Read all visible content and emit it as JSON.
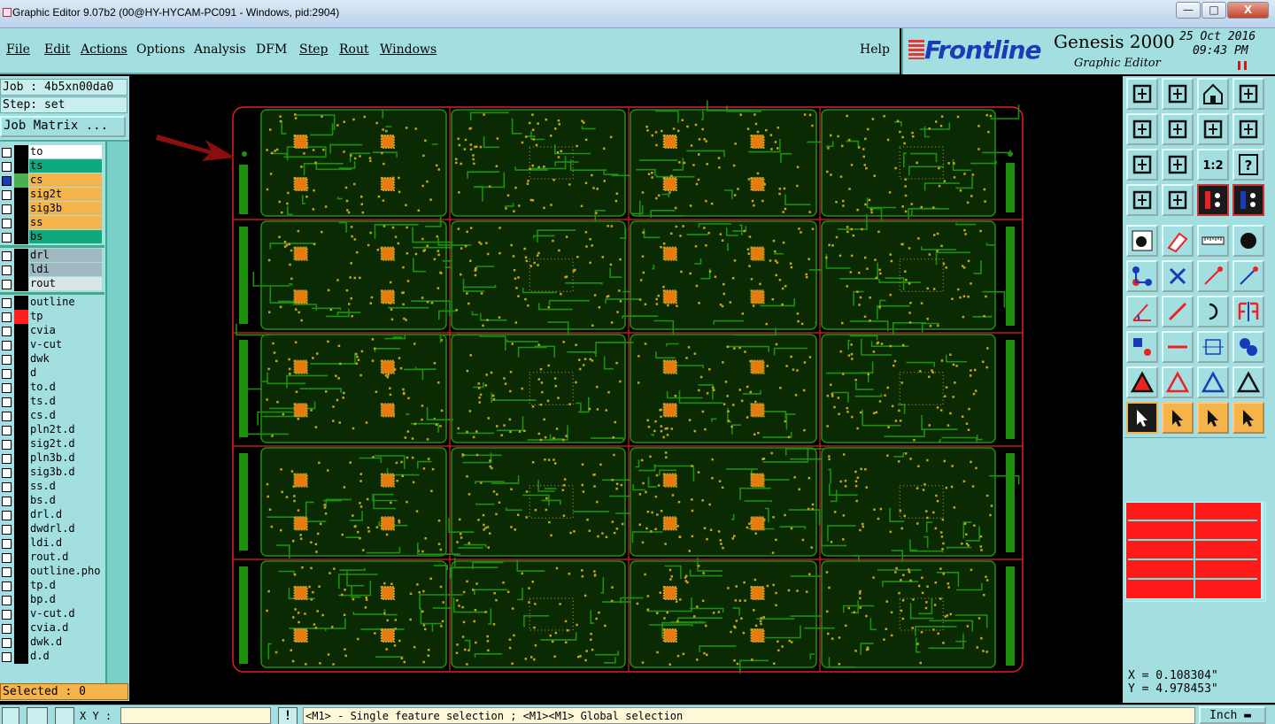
{
  "window": {
    "title": "Graphic Editor 9.07b2 (00@HY-HYCAM-PC091 - Windows, pid:2904)",
    "min": "—",
    "max": "□",
    "close": "X"
  },
  "menu": [
    "File",
    "Edit",
    "Actions",
    "Options",
    "Analysis",
    "DFM",
    "Step",
    "Rout",
    "Windows"
  ],
  "help": "Help",
  "brand": {
    "logo": "Frontline",
    "product": "Genesis 2000",
    "subtitle": "Graphic Editor",
    "date": "25 Oct 2016",
    "time": "09:43 PM"
  },
  "job": {
    "job_line": "Job : 4b5xn00da0",
    "step_line": "Step: set",
    "matrix_button": "Job Matrix ..."
  },
  "layer_groups": [
    [
      {
        "name": "to",
        "color": "#ffffff",
        "checked": false
      },
      {
        "name": "ts",
        "color": "#0fa97e",
        "checked": false
      },
      {
        "name": "cs",
        "color": "#f5b44a",
        "checked": true,
        "marker": "#4caf50"
      },
      {
        "name": "sig2t",
        "color": "#f5b44a",
        "checked": false
      },
      {
        "name": "sig3b",
        "color": "#f5b44a",
        "checked": false
      },
      {
        "name": "ss",
        "color": "#f5b44a",
        "checked": false
      },
      {
        "name": "bs",
        "color": "#0fa97e",
        "checked": false
      }
    ],
    [
      {
        "name": "drl",
        "color": "#a0b8c0",
        "checked": false
      },
      {
        "name": "ldi",
        "color": "#a0b8c0",
        "checked": false
      },
      {
        "name": "rout",
        "color": "#d8e6e8",
        "checked": false
      }
    ],
    [
      {
        "name": "outline",
        "color": "#a3dfe0",
        "checked": false
      },
      {
        "name": "tp",
        "color": "#a3dfe0",
        "checked": false,
        "marker": "#ff2020"
      },
      {
        "name": "cvia",
        "color": "#a3dfe0",
        "checked": false
      },
      {
        "name": "v-cut",
        "color": "#a3dfe0",
        "checked": false
      },
      {
        "name": "dwk",
        "color": "#a3dfe0",
        "checked": false
      },
      {
        "name": "d",
        "color": "#a3dfe0",
        "checked": false
      },
      {
        "name": "to.d",
        "color": "#a3dfe0",
        "checked": false
      },
      {
        "name": "ts.d",
        "color": "#a3dfe0",
        "checked": false
      },
      {
        "name": "cs.d",
        "color": "#a3dfe0",
        "checked": false
      },
      {
        "name": "pln2t.d",
        "color": "#a3dfe0",
        "checked": false
      },
      {
        "name": "sig2t.d",
        "color": "#a3dfe0",
        "checked": false
      },
      {
        "name": "pln3b.d",
        "color": "#a3dfe0",
        "checked": false
      },
      {
        "name": "sig3b.d",
        "color": "#a3dfe0",
        "checked": false
      },
      {
        "name": "ss.d",
        "color": "#a3dfe0",
        "checked": false
      },
      {
        "name": "bs.d",
        "color": "#a3dfe0",
        "checked": false
      },
      {
        "name": "drl.d",
        "color": "#a3dfe0",
        "checked": false
      },
      {
        "name": "dwdrl.d",
        "color": "#a3dfe0",
        "checked": false
      },
      {
        "name": "ldi.d",
        "color": "#a3dfe0",
        "checked": false
      },
      {
        "name": "rout.d",
        "color": "#a3dfe0",
        "checked": false
      },
      {
        "name": "outline.pho",
        "color": "#a3dfe0",
        "checked": false
      },
      {
        "name": "tp.d",
        "color": "#a3dfe0",
        "checked": false
      },
      {
        "name": "bp.d",
        "color": "#a3dfe0",
        "checked": false
      },
      {
        "name": "v-cut.d",
        "color": "#a3dfe0",
        "checked": false
      },
      {
        "name": "cvia.d",
        "color": "#a3dfe0",
        "checked": false
      },
      {
        "name": "dwk.d",
        "color": "#a3dfe0",
        "checked": false
      },
      {
        "name": "d.d",
        "color": "#a3dfe0",
        "checked": false
      }
    ]
  ],
  "selected": "Selected : 0",
  "coords": {
    "x": "X = 0.108304\"",
    "y": "Y = 4.978453\""
  },
  "bottom": {
    "xy_label": "X Y :",
    "xy_value": "",
    "status": "<M1> - Single feature selection ; <M1><M1> Global selection",
    "units": "Inch"
  },
  "toolbar": [
    {
      "name": "zoom-home-icon",
      "style": "normal"
    },
    {
      "name": "zoom-in-icon",
      "style": "normal"
    },
    {
      "name": "home-icon",
      "style": "normal"
    },
    {
      "name": "zoom-window-icon",
      "style": "normal"
    },
    {
      "name": "pan-left-icon",
      "style": "normal"
    },
    {
      "name": "pan-right-icon",
      "style": "normal"
    },
    {
      "name": "pan-up-down-icon",
      "style": "normal"
    },
    {
      "name": "redraw-icon",
      "style": "normal"
    },
    {
      "name": "fit-icon",
      "style": "normal"
    },
    {
      "name": "center-icon",
      "style": "normal"
    },
    {
      "name": "scale-1to2-icon",
      "style": "normal"
    },
    {
      "name": "help-question-icon",
      "style": "normal"
    },
    {
      "name": "measure-icon",
      "style": "normal"
    },
    {
      "name": "snap-icon",
      "style": "normal"
    },
    {
      "name": "layers-red-icon",
      "style": "dark"
    },
    {
      "name": "layers-blue-icon",
      "style": "dark"
    },
    {
      "name": "add-pad-icon",
      "style": "normal"
    },
    {
      "name": "add-surface-icon",
      "style": "normal"
    },
    {
      "name": "ruler-icon",
      "style": "normal"
    },
    {
      "name": "circle-icon",
      "style": "normal"
    },
    {
      "name": "connect-icon",
      "style": "normal"
    },
    {
      "name": "delete-x-icon",
      "style": "normal"
    },
    {
      "name": "line-red-icon",
      "style": "normal"
    },
    {
      "name": "line-blue-icon",
      "style": "normal"
    },
    {
      "name": "angle-icon",
      "style": "normal"
    },
    {
      "name": "diagonal-line-icon",
      "style": "normal"
    },
    {
      "name": "arc-icon",
      "style": "normal"
    },
    {
      "name": "mirror-icon",
      "style": "normal"
    },
    {
      "name": "move-icon",
      "style": "normal"
    },
    {
      "name": "hline-icon",
      "style": "normal"
    },
    {
      "name": "resize-icon",
      "style": "normal"
    },
    {
      "name": "copy-icon",
      "style": "normal"
    },
    {
      "name": "triangle-fill-icon",
      "style": "normal"
    },
    {
      "name": "triangle-red-icon",
      "style": "normal"
    },
    {
      "name": "triangle-blue-icon",
      "style": "normal"
    },
    {
      "name": "triangle-line-icon",
      "style": "normal"
    },
    {
      "name": "select-arrow-icon",
      "style": "darkorange"
    },
    {
      "name": "select-box-icon",
      "style": "orange"
    },
    {
      "name": "select-poly-icon",
      "style": "orange"
    },
    {
      "name": "select-net-icon",
      "style": "orange"
    }
  ],
  "colors": {
    "panel": "#a3dfe0",
    "outline": "#e02020",
    "board_green": "#1f8f10",
    "copper": "#c9a21e"
  }
}
